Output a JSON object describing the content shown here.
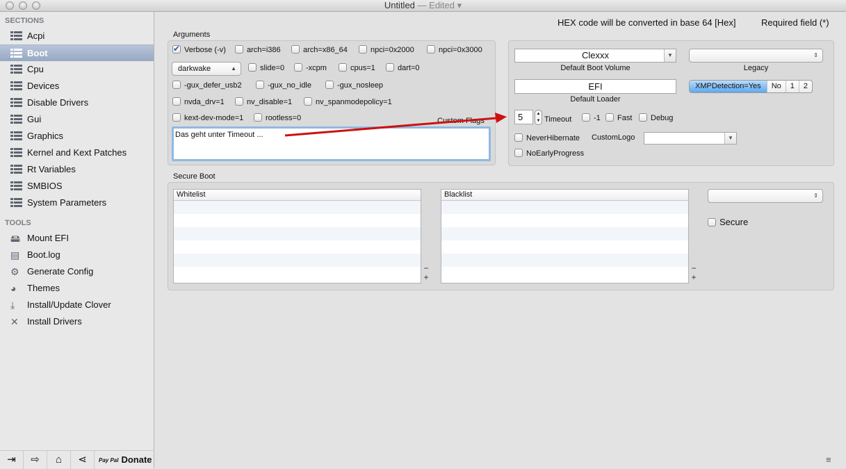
{
  "window": {
    "title": "Untitled",
    "edited": "— Edited ▾"
  },
  "sidebar": {
    "sections_header": "SECTIONS",
    "sections": [
      {
        "label": "Acpi"
      },
      {
        "label": "Boot",
        "selected": true
      },
      {
        "label": "Cpu"
      },
      {
        "label": "Devices"
      },
      {
        "label": "Disable Drivers"
      },
      {
        "label": "Gui"
      },
      {
        "label": "Graphics"
      },
      {
        "label": "Kernel and Kext Patches"
      },
      {
        "label": "Rt Variables"
      },
      {
        "label": "SMBIOS"
      },
      {
        "label": "System Parameters"
      }
    ],
    "tools_header": "TOOLS",
    "tools": [
      {
        "label": "Mount EFI",
        "icon": "disk-icon"
      },
      {
        "label": "Boot.log",
        "icon": "log-icon"
      },
      {
        "label": "Generate Config",
        "icon": "gear-icon"
      },
      {
        "label": "Themes",
        "icon": "palette-icon"
      },
      {
        "label": "Install/Update Clover",
        "icon": "download-icon"
      },
      {
        "label": "Install Drivers",
        "icon": "tools-icon"
      }
    ],
    "bottom": {
      "paypal": "Pay Pal",
      "donate": "Donate"
    }
  },
  "header": {
    "hex_note": "HEX code will be converted in base 64 [Hex]",
    "required": "Required field (*)"
  },
  "arguments": {
    "label": "Arguments",
    "verbose": "Verbose (-v)",
    "arch_i386": "arch=i386",
    "arch_x86_64": "arch=x86_64",
    "npci2000": "npci=0x2000",
    "npci3000": "npci=0x3000",
    "darkwake": "darkwake",
    "slide": "slide=0",
    "xcpm": "-xcpm",
    "cpus": "cpus=1",
    "dart": "dart=0",
    "gux_defer": "-gux_defer_usb2",
    "gux_no_idle": "-gux_no_idle",
    "gux_nosleep": "-gux_nosleep",
    "nvda": "nvda_drv=1",
    "nv_disable": "nv_disable=1",
    "nv_span": "nv_spanmodepolicy=1",
    "kext_dev": "kext-dev-mode=1",
    "rootless": "rootless=0",
    "custom_flags_label": "Custom Flags",
    "custom_flags_value": "Das geht unter Timeout ..."
  },
  "boot": {
    "default_volume": "Clexxx",
    "default_volume_label": "Default Boot Volume",
    "legacy_label": "Legacy",
    "default_loader": "EFI",
    "default_loader_label": "Default Loader",
    "xmp": [
      "XMPDetection=Yes",
      "No",
      "1",
      "2"
    ],
    "timeout_value": "5",
    "timeout_label": "Timeout",
    "minus1": "-1",
    "fast": "Fast",
    "debug": "Debug",
    "never_hibernate": "NeverHibernate",
    "custom_logo": "CustomLogo",
    "no_early": "NoEarlyProgress"
  },
  "secure_boot": {
    "label": "Secure Boot",
    "whitelist": "Whitelist",
    "blacklist": "Blacklist",
    "secure": "Secure",
    "minus": "−",
    "plus": "+"
  },
  "colors": {
    "selection": "#97a8c4",
    "annotation_arrow": "#cc1111",
    "focus": "#8fb9e3"
  }
}
